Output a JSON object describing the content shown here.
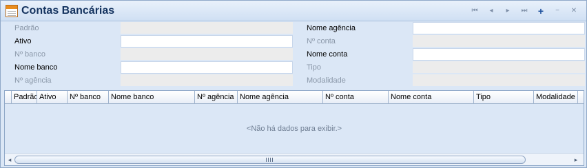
{
  "window": {
    "title": "Contas Bancárias"
  },
  "nav": {
    "first": "⏮",
    "prev": "◂",
    "next": "▸",
    "last": "⏭",
    "add": "+",
    "remove": "−",
    "close": "✕"
  },
  "form": {
    "left": [
      {
        "label": "Padrão",
        "style": "dim",
        "editable": false,
        "value": ""
      },
      {
        "label": "Ativo",
        "style": "norm",
        "editable": true,
        "value": ""
      },
      {
        "label": "Nº banco",
        "style": "dim",
        "editable": false,
        "value": ""
      },
      {
        "label": "Nome banco",
        "style": "norm",
        "editable": true,
        "value": ""
      },
      {
        "label": "Nº agência",
        "style": "dim",
        "editable": false,
        "value": ""
      }
    ],
    "right": [
      {
        "label": "Nome agência",
        "style": "norm",
        "editable": true,
        "value": ""
      },
      {
        "label": "Nº conta",
        "style": "dim",
        "editable": false,
        "value": ""
      },
      {
        "label": "Nome conta",
        "style": "norm",
        "editable": true,
        "value": ""
      },
      {
        "label": "Tipo",
        "style": "dim",
        "editable": false,
        "value": ""
      },
      {
        "label": "Modalidade",
        "style": "dim",
        "editable": false,
        "value": ""
      }
    ]
  },
  "grid": {
    "columns": [
      "Padrão",
      "Ativo",
      "Nº banco",
      "Nome banco",
      "Nº agência",
      "Nome agência",
      "Nº conta",
      "Nome conta",
      "Tipo",
      "Modalidade"
    ],
    "empty_message": "<Não há dados para exibir.>",
    "scroll_left": "◂",
    "scroll_right": "▸"
  }
}
